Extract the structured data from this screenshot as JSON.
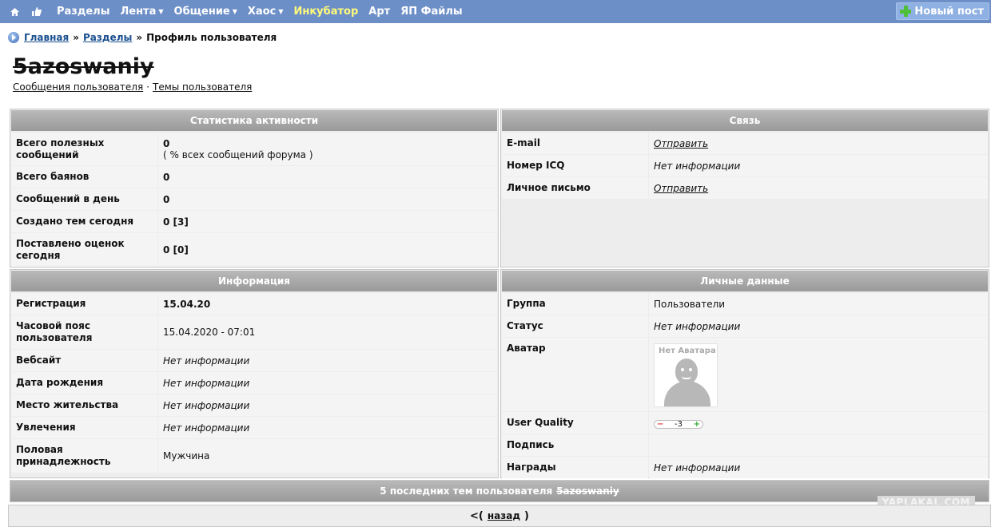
{
  "nav": {
    "items": [
      {
        "label": "Разделы",
        "caret": false,
        "highlight": false
      },
      {
        "label": "Лента",
        "caret": true,
        "highlight": false
      },
      {
        "label": "Общение",
        "caret": true,
        "highlight": false
      },
      {
        "label": "Хаос",
        "caret": true,
        "highlight": false
      },
      {
        "label": "Инкубатор",
        "caret": false,
        "highlight": true
      },
      {
        "label": "Арт",
        "caret": false,
        "highlight": false
      },
      {
        "label": "ЯП Файлы",
        "caret": false,
        "highlight": false
      }
    ],
    "new_post": "Новый пост",
    "caret_glyph": "▼"
  },
  "breadcrumb": {
    "home": "Главная",
    "sections": "Разделы",
    "current": "Профиль пользователя",
    "sep": "»"
  },
  "user": {
    "name": "5azoswaniy",
    "link_posts": "Сообщения пользователя",
    "link_topics": "Темы пользователя",
    "link_sep": "·"
  },
  "stats": {
    "title": "Статистика активности",
    "rows": [
      {
        "label": "Всего полезных сообщений",
        "value": "0",
        "sub": "( % всех сообщений форума )"
      },
      {
        "label": "Всего баянов",
        "value": "0"
      },
      {
        "label": "Сообщений в день",
        "value": "0"
      },
      {
        "label": "Создано тем сегодня",
        "value": "0 [3]"
      },
      {
        "label": "Поставлено оценок сегодня",
        "value": "0 [0]"
      }
    ]
  },
  "contact": {
    "title": "Связь",
    "rows": [
      {
        "label": "E-mail",
        "value": "Отправить"
      },
      {
        "label": "Номер ICQ",
        "value": "Нет информации"
      },
      {
        "label": "Личное письмо",
        "value": "Отправить"
      }
    ]
  },
  "info": {
    "title": "Информация",
    "rows": [
      {
        "label": "Регистрация",
        "value": "15.04.20"
      },
      {
        "label": "Часовой пояс пользователя",
        "value": "15.04.2020 - 07:01"
      },
      {
        "label": "Вебсайт",
        "value": "Нет информации"
      },
      {
        "label": "Дата рождения",
        "value": "Нет информации"
      },
      {
        "label": "Место жительства",
        "value": "Нет информации"
      },
      {
        "label": "Увлечения",
        "value": "Нет информации"
      },
      {
        "label": "Половая принадлежность",
        "value": "Мужчина"
      }
    ]
  },
  "personal": {
    "title": "Личные данные",
    "rows": [
      {
        "label": "Группа",
        "value": "Пользователи"
      },
      {
        "label": "Статус",
        "value": "Нет информации"
      },
      {
        "label": "Аватар",
        "avatar_text": "Нет Аватара"
      },
      {
        "label": "User Quality",
        "value": "-3",
        "minus": "−",
        "plus": "+"
      },
      {
        "label": "Подпись",
        "value": ""
      },
      {
        "label": "Награды",
        "value": "Нет информации"
      }
    ]
  },
  "recent": {
    "title_prefix": "5 последних тем пользователя",
    "title_user": "5azoswaniy"
  },
  "back": {
    "open": "<(",
    "label": "назад",
    "close": ")"
  },
  "watermark": "YAPLAKAL.COM"
}
